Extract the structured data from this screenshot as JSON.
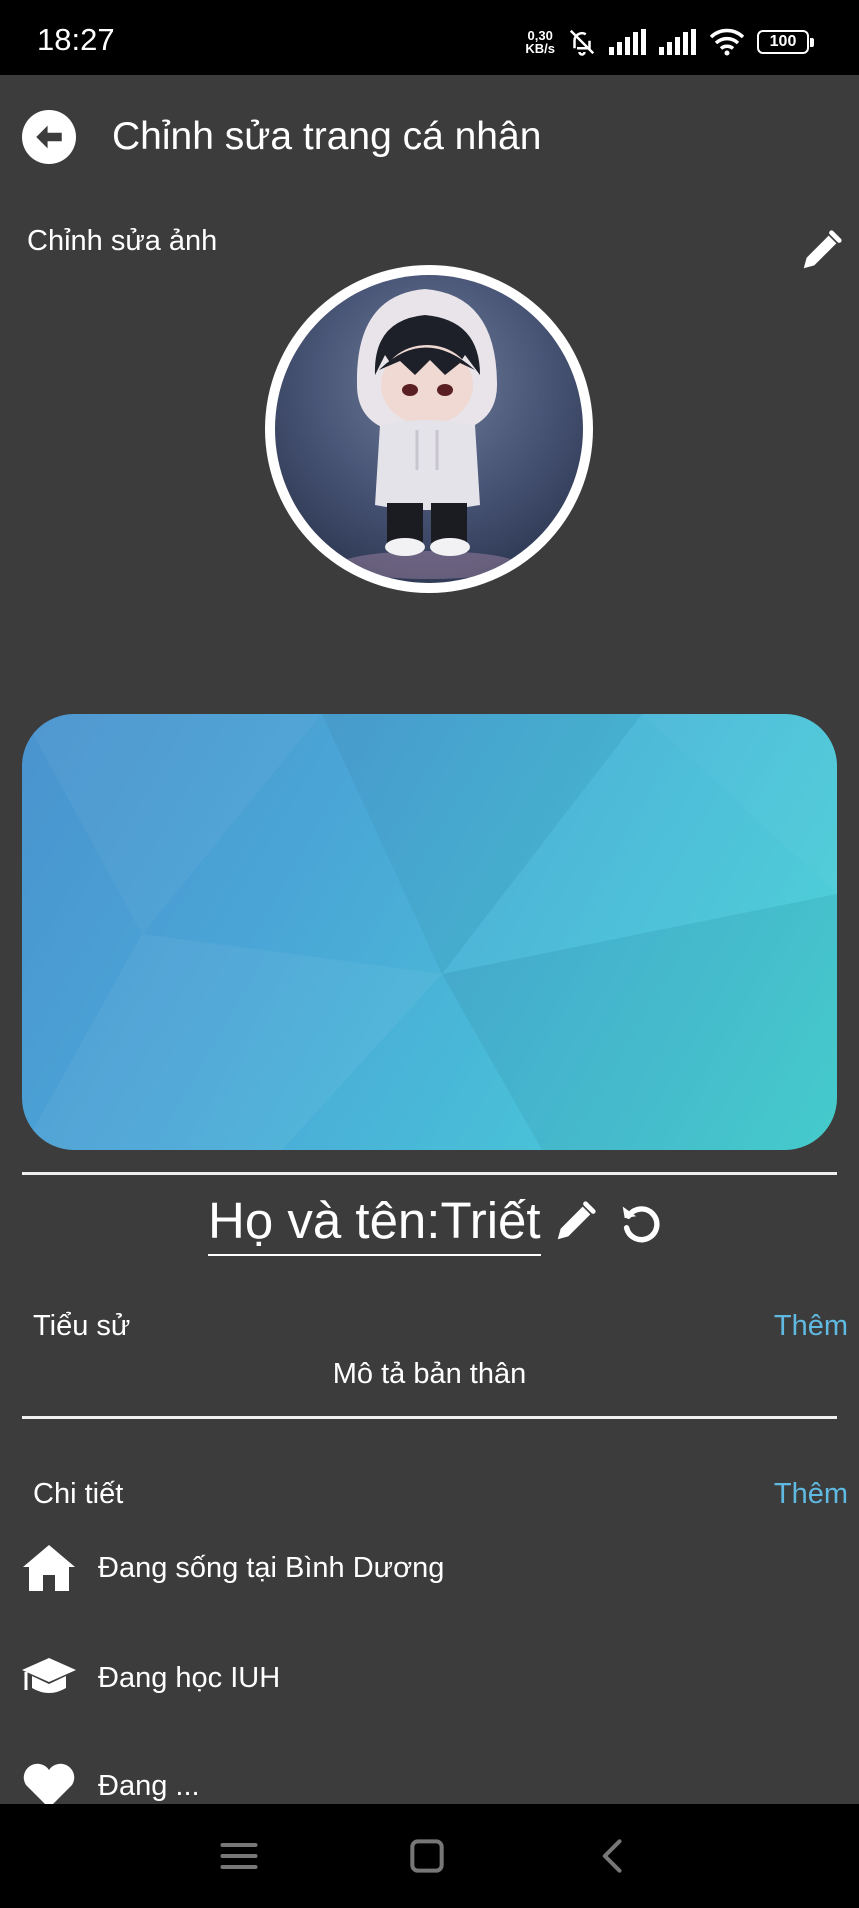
{
  "status_bar": {
    "time": "18:27",
    "net_speed_value": "0,30",
    "net_speed_unit": "KB/s",
    "battery": "100",
    "icons": [
      "mute-bell-icon",
      "signal-icon",
      "signal-icon",
      "wifi-icon",
      "battery-icon"
    ]
  },
  "header": {
    "title": "Chỉnh sửa trang cá nhân",
    "back_icon": "arrow-left-circle-icon"
  },
  "photo_section": {
    "label": "Chỉnh sửa ảnh",
    "edit_icon": "pencil-icon"
  },
  "profile": {
    "name_label": "Họ và tên:Triết"
  },
  "bio": {
    "label": "Tiểu sử",
    "action": "Thêm",
    "placeholder": "Mô tả bản thân"
  },
  "details": {
    "label": "Chi tiết",
    "action": "Thêm",
    "items": [
      {
        "icon": "home-icon",
        "text": "Đang sống tại Bình Dương"
      },
      {
        "icon": "graduation-cap-icon",
        "text": "Đang học IUH"
      },
      {
        "icon": "heart-icon",
        "text": "Đang ..."
      }
    ]
  },
  "nav_bar": {
    "buttons": [
      "menu-icon",
      "home-square-icon",
      "back-chevron-icon"
    ]
  },
  "colors": {
    "background": "#3c3c3c",
    "accent": "#5fb9e0",
    "status_bar": "#000000"
  }
}
